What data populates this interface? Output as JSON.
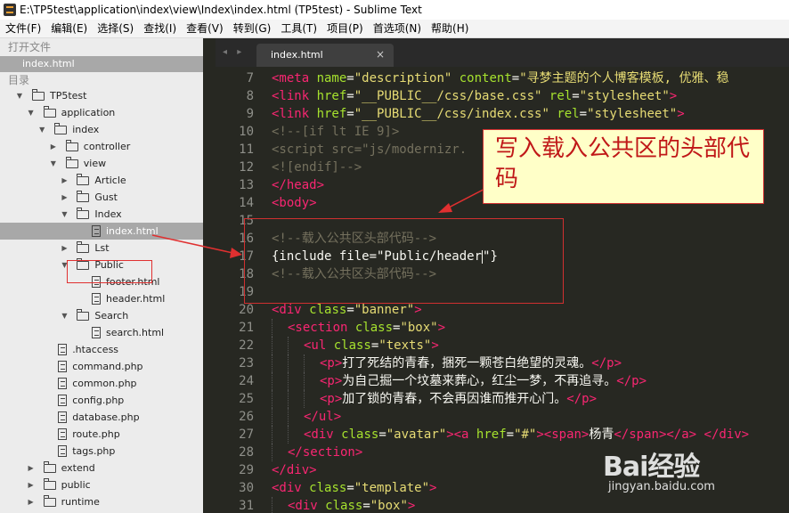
{
  "window": {
    "title": "E:\\TP5test\\application\\index\\view\\Index\\index.html (TP5test) - Sublime Text"
  },
  "menu": [
    "文件(F)",
    "编辑(E)",
    "选择(S)",
    "查找(I)",
    "查看(V)",
    "转到(G)",
    "工具(T)",
    "项目(P)",
    "首选项(N)",
    "帮助(H)"
  ],
  "sidebar": {
    "open_files_header": "打开文件",
    "open_file": "index.html",
    "folders_header": "目录",
    "tree": [
      {
        "label": "TP5test",
        "type": "folder",
        "depth": 0,
        "open": true
      },
      {
        "label": "application",
        "type": "folder",
        "depth": 1,
        "open": true
      },
      {
        "label": "index",
        "type": "folder",
        "depth": 2,
        "open": true
      },
      {
        "label": "controller",
        "type": "folder",
        "depth": 3,
        "open": false
      },
      {
        "label": "view",
        "type": "folder",
        "depth": 3,
        "open": true
      },
      {
        "label": "Article",
        "type": "folder",
        "depth": 4,
        "open": false
      },
      {
        "label": "Gust",
        "type": "folder",
        "depth": 4,
        "open": false
      },
      {
        "label": "Index",
        "type": "folder",
        "depth": 4,
        "open": true
      },
      {
        "label": "index.html",
        "type": "file",
        "depth": 5,
        "selected": true
      },
      {
        "label": "Lst",
        "type": "folder",
        "depth": 4,
        "open": false
      },
      {
        "label": "Public",
        "type": "folder",
        "depth": 4,
        "open": true
      },
      {
        "label": "footer.html",
        "type": "file",
        "depth": 5
      },
      {
        "label": "header.html",
        "type": "file",
        "depth": 5
      },
      {
        "label": "Search",
        "type": "folder",
        "depth": 4,
        "open": true
      },
      {
        "label": "search.html",
        "type": "file",
        "depth": 5
      },
      {
        "label": ".htaccess",
        "type": "file",
        "depth": 2
      },
      {
        "label": "command.php",
        "type": "file",
        "depth": 2
      },
      {
        "label": "common.php",
        "type": "file",
        "depth": 2
      },
      {
        "label": "config.php",
        "type": "file",
        "depth": 2
      },
      {
        "label": "database.php",
        "type": "file",
        "depth": 2
      },
      {
        "label": "route.php",
        "type": "file",
        "depth": 2
      },
      {
        "label": "tags.php",
        "type": "file",
        "depth": 2
      },
      {
        "label": "extend",
        "type": "folder",
        "depth": 1,
        "open": false
      },
      {
        "label": "public",
        "type": "folder",
        "depth": 1,
        "open": false
      },
      {
        "label": "runtime",
        "type": "folder",
        "depth": 1,
        "open": false
      }
    ]
  },
  "tabs": [
    {
      "label": "index.html",
      "close": "×"
    }
  ],
  "tab_nav": "◂ ▸",
  "editor": {
    "lines": [
      {
        "n": "7",
        "indent": 0,
        "tokens": [
          [
            "tg",
            "<meta "
          ],
          [
            "at",
            "name"
          ],
          [
            "wt",
            "="
          ],
          [
            "st",
            "\"description\""
          ],
          [
            "wt",
            " "
          ],
          [
            "at",
            "content"
          ],
          [
            "wt",
            "="
          ],
          [
            "st",
            "\"寻梦主题的个人博客模板, 优雅、稳"
          ]
        ]
      },
      {
        "n": "8",
        "indent": 0,
        "tokens": [
          [
            "tg",
            "<link "
          ],
          [
            "at",
            "href"
          ],
          [
            "wt",
            "="
          ],
          [
            "st",
            "\"__PUBLIC__/css/base.css\""
          ],
          [
            "wt",
            " "
          ],
          [
            "at",
            "rel"
          ],
          [
            "wt",
            "="
          ],
          [
            "st",
            "\"stylesheet\""
          ],
          [
            "tg",
            ">"
          ]
        ]
      },
      {
        "n": "9",
        "indent": 0,
        "tokens": [
          [
            "tg",
            "<link "
          ],
          [
            "at",
            "href"
          ],
          [
            "wt",
            "="
          ],
          [
            "st",
            "\"__PUBLIC__/css/index.css\""
          ],
          [
            "wt",
            " "
          ],
          [
            "at",
            "rel"
          ],
          [
            "wt",
            "="
          ],
          [
            "st",
            "\"stylesheet\""
          ],
          [
            "tg",
            ">"
          ]
        ]
      },
      {
        "n": "10",
        "indent": 0,
        "tokens": [
          [
            "cm",
            "<!--[if lt IE 9]>"
          ]
        ]
      },
      {
        "n": "11",
        "indent": 0,
        "tokens": [
          [
            "cm",
            "<script src=\"js/modernizr."
          ]
        ]
      },
      {
        "n": "12",
        "indent": 0,
        "tokens": [
          [
            "cm",
            "<![endif]-->"
          ]
        ]
      },
      {
        "n": "13",
        "indent": 0,
        "tokens": [
          [
            "tg",
            "</head>"
          ]
        ]
      },
      {
        "n": "14",
        "indent": 0,
        "tokens": [
          [
            "tg",
            "<body>"
          ]
        ]
      },
      {
        "n": "15",
        "indent": 0,
        "tokens": []
      },
      {
        "n": "16",
        "indent": 0,
        "tokens": [
          [
            "cm",
            "<!--载入公共区头部代码-->"
          ]
        ]
      },
      {
        "n": "17",
        "indent": 0,
        "tokens": [
          [
            "wt",
            "{include file=\"Public/header"
          ],
          [
            "caret",
            ""
          ],
          [
            "wt",
            "\"}"
          ]
        ]
      },
      {
        "n": "18",
        "indent": 0,
        "tokens": [
          [
            "cm",
            "<!--载入公共区头部代码-->"
          ]
        ]
      },
      {
        "n": "19",
        "indent": 0,
        "tokens": []
      },
      {
        "n": "20",
        "indent": 0,
        "tokens": [
          [
            "tg",
            "<div "
          ],
          [
            "at",
            "class"
          ],
          [
            "wt",
            "="
          ],
          [
            "st",
            "\"banner\""
          ],
          [
            "tg",
            ">"
          ]
        ]
      },
      {
        "n": "21",
        "indent": 1,
        "tokens": [
          [
            "tg",
            "<section "
          ],
          [
            "at",
            "class"
          ],
          [
            "wt",
            "="
          ],
          [
            "st",
            "\"box\""
          ],
          [
            "tg",
            ">"
          ]
        ]
      },
      {
        "n": "22",
        "indent": 2,
        "tokens": [
          [
            "tg",
            "<ul "
          ],
          [
            "at",
            "class"
          ],
          [
            "wt",
            "="
          ],
          [
            "st",
            "\"texts\""
          ],
          [
            "tg",
            ">"
          ]
        ]
      },
      {
        "n": "23",
        "indent": 3,
        "tokens": [
          [
            "tg",
            "<p>"
          ],
          [
            "wt",
            "打了死结的青春，捆死一颗苍白绝望的灵魂。"
          ],
          [
            "tg",
            "</p>"
          ]
        ]
      },
      {
        "n": "24",
        "indent": 3,
        "tokens": [
          [
            "tg",
            "<p>"
          ],
          [
            "wt",
            "为自己掘一个坟墓来葬心，红尘一梦，不再追寻。"
          ],
          [
            "tg",
            "</p>"
          ]
        ]
      },
      {
        "n": "25",
        "indent": 3,
        "tokens": [
          [
            "tg",
            "<p>"
          ],
          [
            "wt",
            "加了锁的青春，不会再因谁而推开心门。"
          ],
          [
            "tg",
            "</p>"
          ]
        ]
      },
      {
        "n": "26",
        "indent": 2,
        "tokens": [
          [
            "tg",
            "</ul>"
          ]
        ]
      },
      {
        "n": "27",
        "indent": 2,
        "tokens": [
          [
            "tg",
            "<div "
          ],
          [
            "at",
            "class"
          ],
          [
            "wt",
            "="
          ],
          [
            "st",
            "\"avatar\""
          ],
          [
            "tg",
            "><a "
          ],
          [
            "at",
            "href"
          ],
          [
            "wt",
            "="
          ],
          [
            "st",
            "\"#\""
          ],
          [
            "tg",
            "><span>"
          ],
          [
            "wt",
            "杨青"
          ],
          [
            "tg",
            "</span></a> </div>"
          ]
        ]
      },
      {
        "n": "28",
        "indent": 1,
        "tokens": [
          [
            "tg",
            "</section>"
          ]
        ]
      },
      {
        "n": "29",
        "indent": 0,
        "tokens": [
          [
            "tg",
            "</div>"
          ]
        ]
      },
      {
        "n": "30",
        "indent": 0,
        "tokens": [
          [
            "tg",
            "<div "
          ],
          [
            "at",
            "class"
          ],
          [
            "wt",
            "="
          ],
          [
            "st",
            "\"template\""
          ],
          [
            "tg",
            ">"
          ]
        ]
      },
      {
        "n": "31",
        "indent": 1,
        "tokens": [
          [
            "tg",
            "<div "
          ],
          [
            "at",
            "class"
          ],
          [
            "wt",
            "="
          ],
          [
            "st",
            "\"box\""
          ],
          [
            "tg",
            ">"
          ]
        ]
      }
    ]
  },
  "callout": {
    "text": "写入载入公共区的头部代码"
  },
  "watermark": {
    "logo": "Bai经验",
    "url": "jingyan.baidu.com"
  },
  "colors": {
    "tag": "#f92672",
    "attr": "#a6e22e",
    "string": "#e6db74",
    "comment": "#75715e",
    "annotation": "#d03030"
  }
}
